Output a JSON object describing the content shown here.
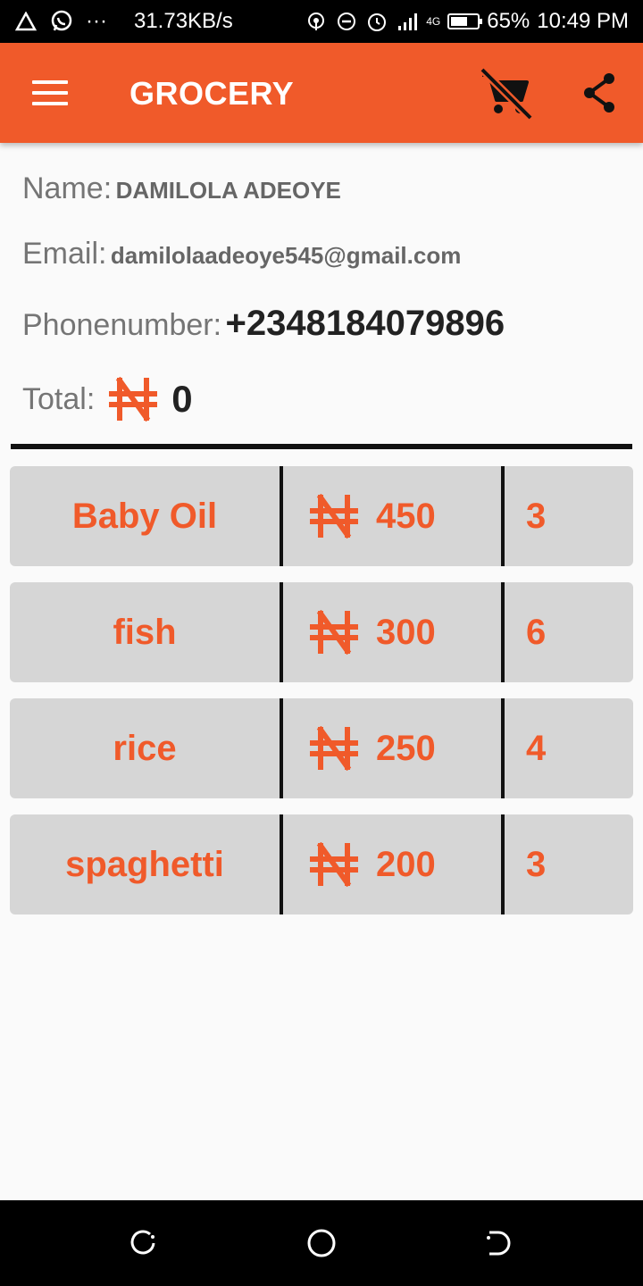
{
  "status_bar": {
    "speed": "31.73KB/s",
    "network": "4G",
    "battery": "65%",
    "battery_level": 0.65,
    "time": "10:49 PM",
    "dots": "···"
  },
  "app_bar": {
    "title": "GROCERY",
    "icons": [
      "menu-icon",
      "remove-shopping-cart-icon",
      "share-icon"
    ],
    "color": "#f05a2a"
  },
  "user": {
    "name_label": "Name:",
    "name": "DAMILOLA ADEOYE",
    "email_label": "Email:",
    "email": "damilolaadeoye545@gmail.com",
    "phone_label": "Phonenumber:",
    "phone": "+2348184079896",
    "total_label": "Total:",
    "total": "0"
  },
  "items": [
    {
      "name": "Baby Oil",
      "price": "450",
      "qty": "3"
    },
    {
      "name": "fish",
      "price": "300",
      "qty": "6"
    },
    {
      "name": "rice",
      "price": "250",
      "qty": "4"
    },
    {
      "name": "spaghetti",
      "price": "200",
      "qty": "3"
    }
  ],
  "currency_icon": "naira-icon",
  "nav_bar": {
    "icons": [
      "recent-apps-icon",
      "home-icon",
      "back-icon"
    ]
  }
}
